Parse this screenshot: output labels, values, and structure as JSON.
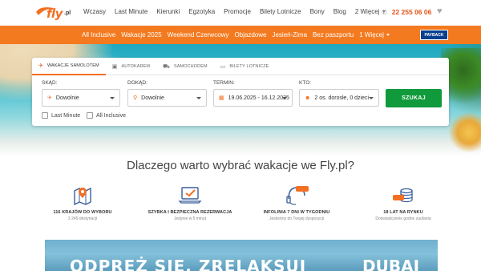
{
  "header": {
    "logo_brand": "fly",
    "logo_tld": ".pl",
    "nav": [
      "Wczasy",
      "Last Minute",
      "Kierunki",
      "Egzotyka",
      "Promocje",
      "Bilety Lotnicze",
      "Bony",
      "Blog"
    ],
    "nav_more": "2 Więcej",
    "phone": "22 255 06 06",
    "icons": {
      "phone": "phone-icon",
      "favorites": "heart-icon"
    }
  },
  "subnav": {
    "items": [
      "All Inclusive",
      "Wakacje 2025",
      "Weekend Czerwcowy",
      "Objazdowe",
      "Jesień-Zima",
      "Bez paszportu"
    ],
    "more": "1 Więcej",
    "payback": "PAYBACK"
  },
  "search": {
    "tabs": [
      {
        "label": "WAKACJE SAMOLOTEM",
        "icon": "plane-icon",
        "active": true
      },
      {
        "label": "AUTOKAREM",
        "icon": "bus-icon",
        "active": false
      },
      {
        "label": "SAMOCHODEM",
        "icon": "car-icon",
        "active": false
      },
      {
        "label": "BILETY LOTNICZE",
        "icon": "ticket-icon",
        "active": false
      }
    ],
    "from_label": "SKĄD:",
    "from_value": "Dowolnie",
    "to_label": "DOKĄD:",
    "to_value": "Dowolnie",
    "date_label": "TERMIN:",
    "date_value": "19.06.2025 - 16.12.2025",
    "who_label": "KTO:",
    "who_value": "2 os. dorosłe, 0 dzieci",
    "submit": "SZUKAJ",
    "checkboxes": [
      "Last Minute",
      "All Inclusive"
    ]
  },
  "why": {
    "title": "Dlaczego warto wybrać wakacje we Fly.pl?",
    "features": [
      {
        "title": "116 KRAJÓW DO WYBORU",
        "subtitle": "3 245 destynacji",
        "icon": "map-pin-icon"
      },
      {
        "title": "SZYBKA I BEZPIECZNA REZERWACJA",
        "subtitle": "Jedynie w 5 minut",
        "icon": "laptop-check-icon"
      },
      {
        "title": "INFOLINIA 7 DNI W TYGODNIU",
        "subtitle": "Jesteśmy do Twojej dyspozycji",
        "icon": "headset-icon",
        "badge": "7 dni"
      },
      {
        "title": "18 LAT NA RYNKU",
        "subtitle": "Doświadczenie godne zaufania",
        "icon": "coins-icon",
        "badge": "18 lat"
      }
    ]
  },
  "banner": {
    "text": "ODPRĘŻ SIĘ. ZRELAKSUJ",
    "destination": "DUBAI"
  },
  "colors": {
    "brand_orange": "#f47a20",
    "accent_green": "#109a3b",
    "phone_color": "#e8541a"
  }
}
